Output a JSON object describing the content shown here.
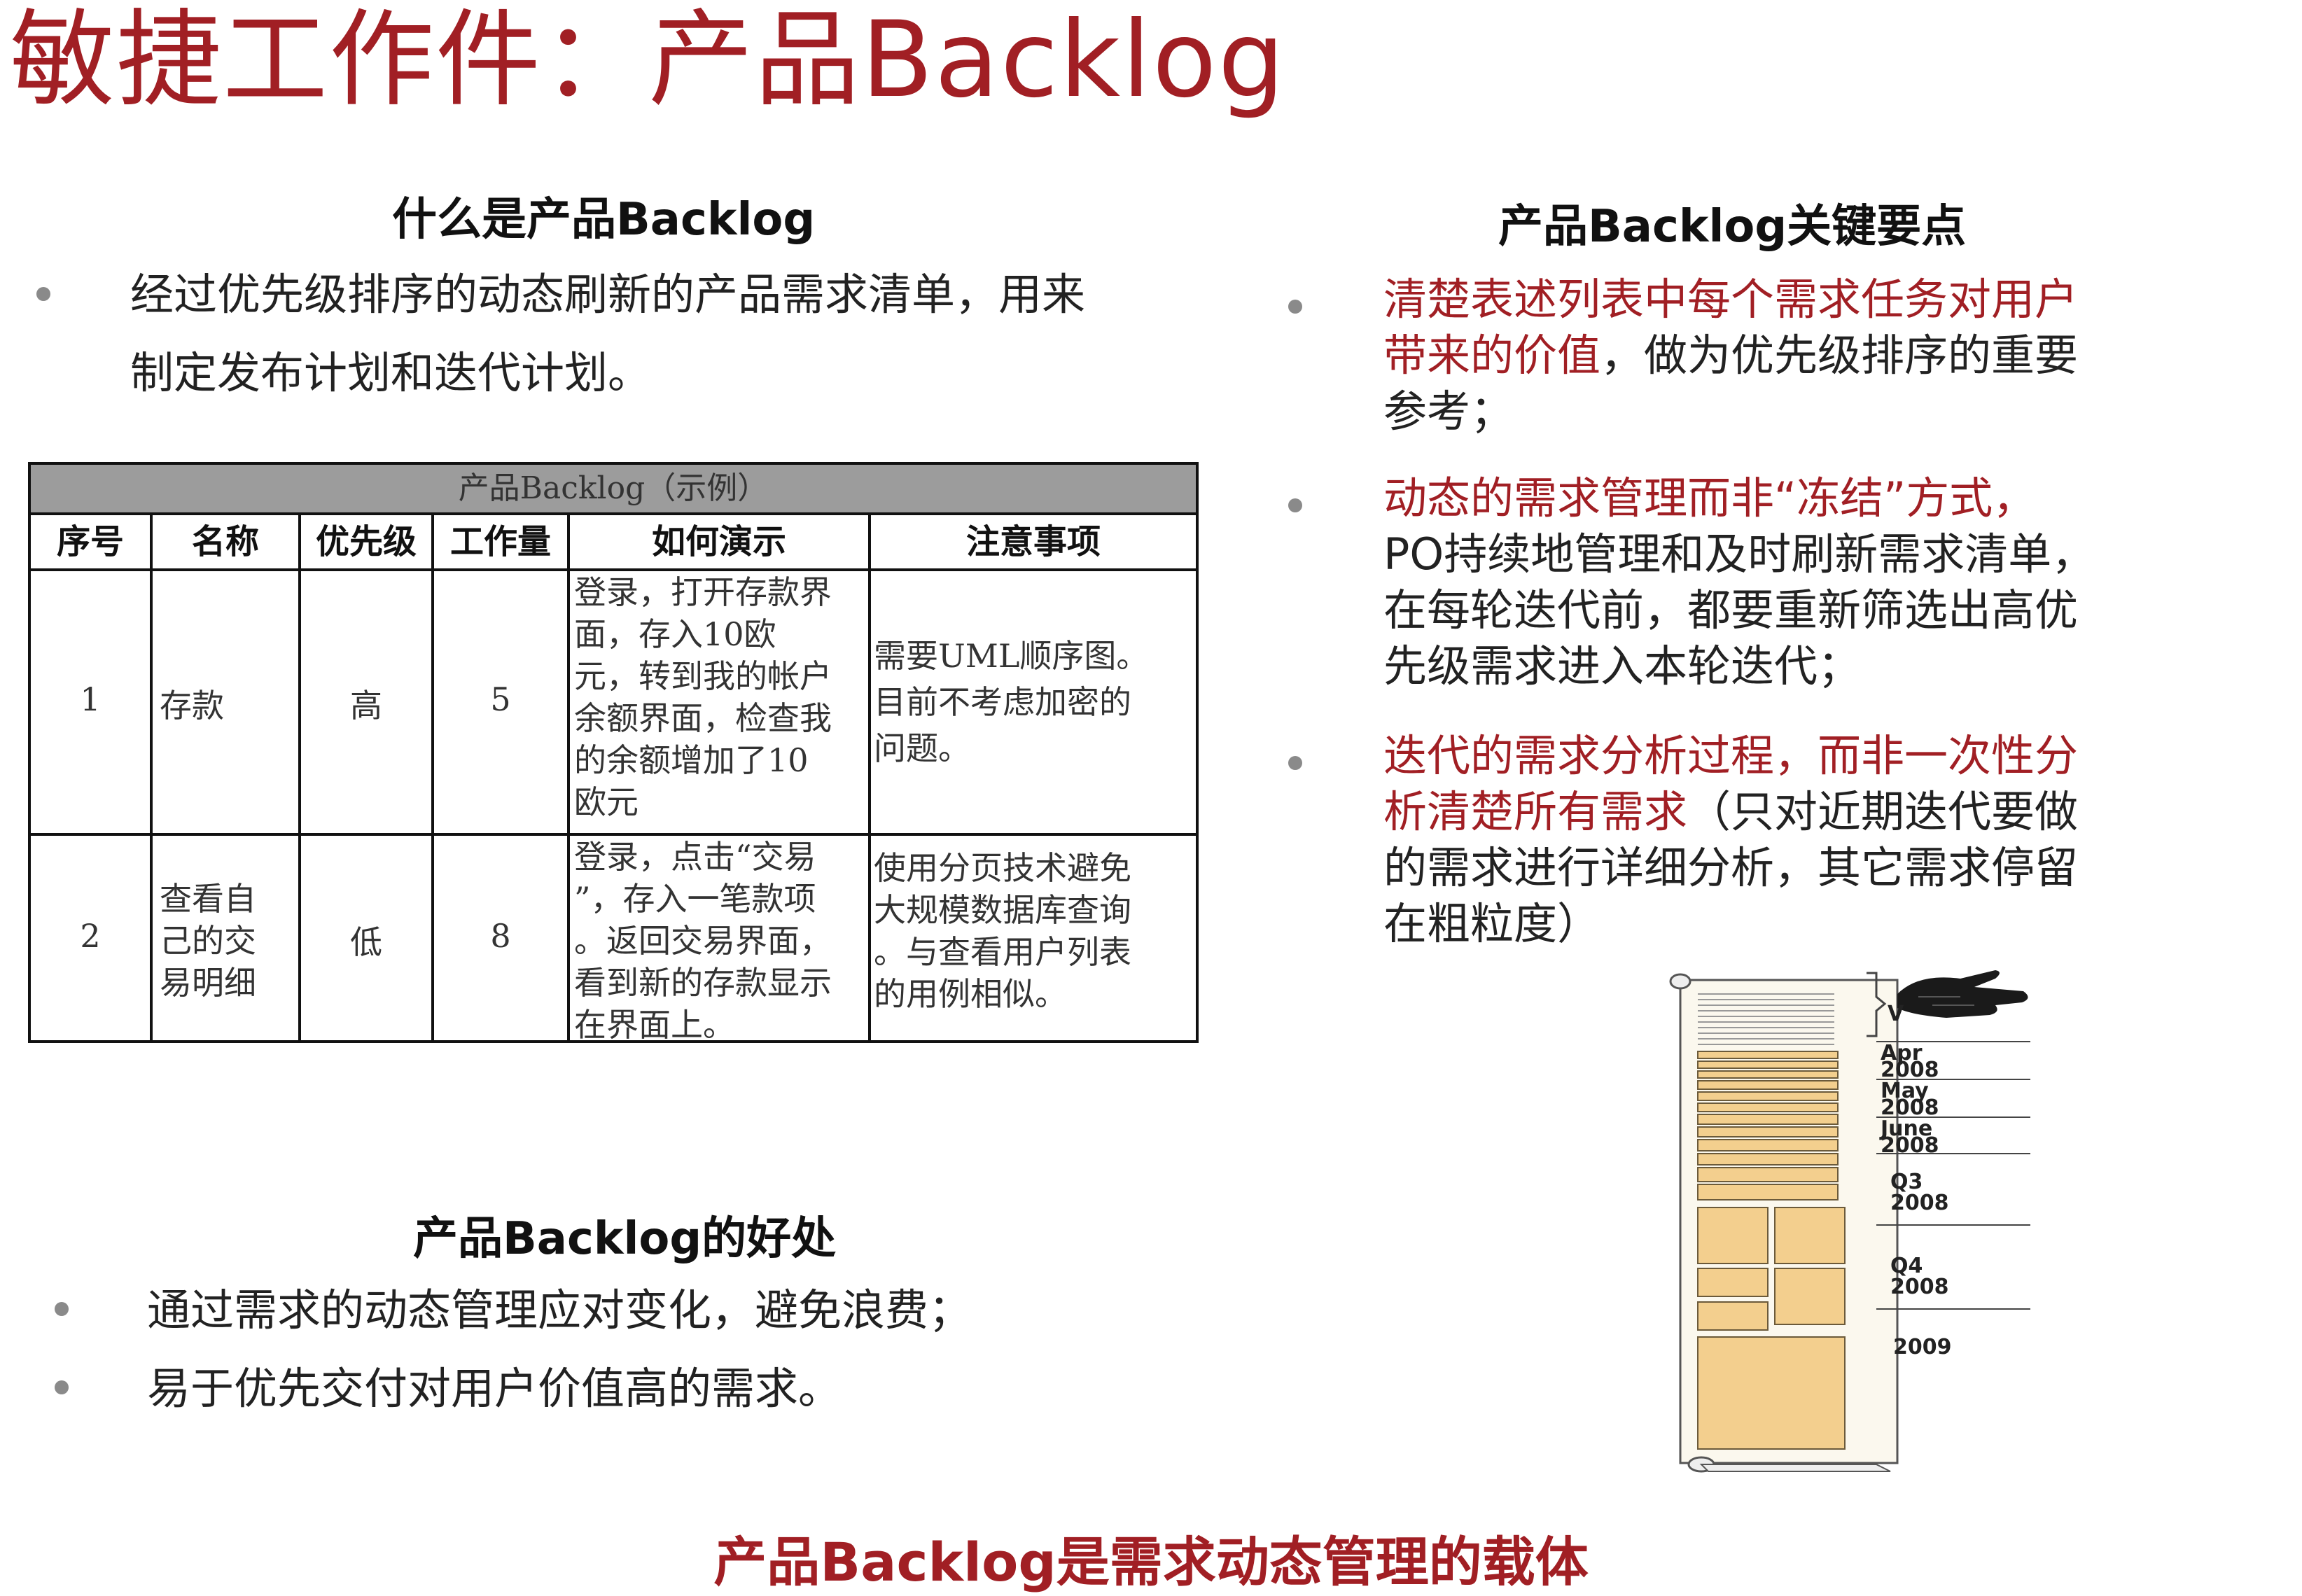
{
  "title": "敏捷工作件：产品Backlog",
  "what": {
    "heading": "什么是产品Backlog",
    "line1": "经过优先级排序的动态刷新的产品需求清单，用来",
    "line2": "制定发布计划和迭代计划。"
  },
  "table": {
    "caption": "产品Backlog（示例）",
    "headers": [
      "序号",
      "名称",
      "优先级",
      "工作量",
      "如何演示",
      "注意事项"
    ],
    "rows": [
      {
        "no": "1",
        "name": "存款",
        "priority": "高",
        "effort": "5",
        "demo": [
          "登录，打开存款界",
          "面，存入10欧",
          "元，转到我的帐户",
          "余额界面，检查我",
          "的余额增加了10",
          "欧元"
        ],
        "notes": [
          "需要UML顺序图。",
          "目前不考虑加密的",
          "问题。"
        ]
      },
      {
        "no": "2",
        "name": [
          "查看自",
          "己的交",
          "易明细"
        ],
        "priority": "低",
        "effort": "8",
        "demo": [
          "登录，点击“交易",
          "”，存入一笔款项",
          "。返回交易界面，",
          "看到新的存款显示",
          "在界面上。"
        ],
        "notes": [
          "使用分页技术避免",
          "大规模数据库查询",
          "。与查看用户列表",
          "的用例相似。"
        ]
      }
    ]
  },
  "benefits": {
    "heading": "产品Backlog的好处",
    "items": [
      "通过需求的动态管理应对变化，避免浪费；",
      "易于优先交付对用户价值高的需求。"
    ]
  },
  "keypoints": {
    "heading": "产品Backlog关键要点",
    "p1": {
      "red_a": "清楚表述列表中每个需求任务对用户",
      "red_b": "带来的价值",
      "black_b": "，做为优先级排序的重要",
      "black_c": "参考；"
    },
    "p2": {
      "red_a": "动态的需求管理而非“冻结”方式，",
      "black_b": "PO持续地管理和及时刷新需求清单，",
      "black_c": "在每轮迭代前，都要重新筛选出高优",
      "black_d": "先级需求进入本轮迭代；"
    },
    "p3": {
      "red_a": "迭代的需求分析过程，而非一次性分",
      "red_b": "析清楚所有需求",
      "black_b": "（只对近期迭代要做",
      "black_c": "的需求进行详细分析，其它需求停留",
      "black_d": "在粗粒度）"
    }
  },
  "timeline": {
    "labels": [
      "Apr",
      "2008",
      "May",
      "2008",
      "June",
      "2008",
      "Q3",
      "2008",
      "Q4",
      "2008",
      "2009"
    ],
    "v_label": "V"
  },
  "footer": "产品Backlog是需求动态管理的载体",
  "colors": {
    "accent": "#a11f24",
    "caption_bg": "#9c9c9c",
    "card_fill": "#f3cf8e"
  }
}
